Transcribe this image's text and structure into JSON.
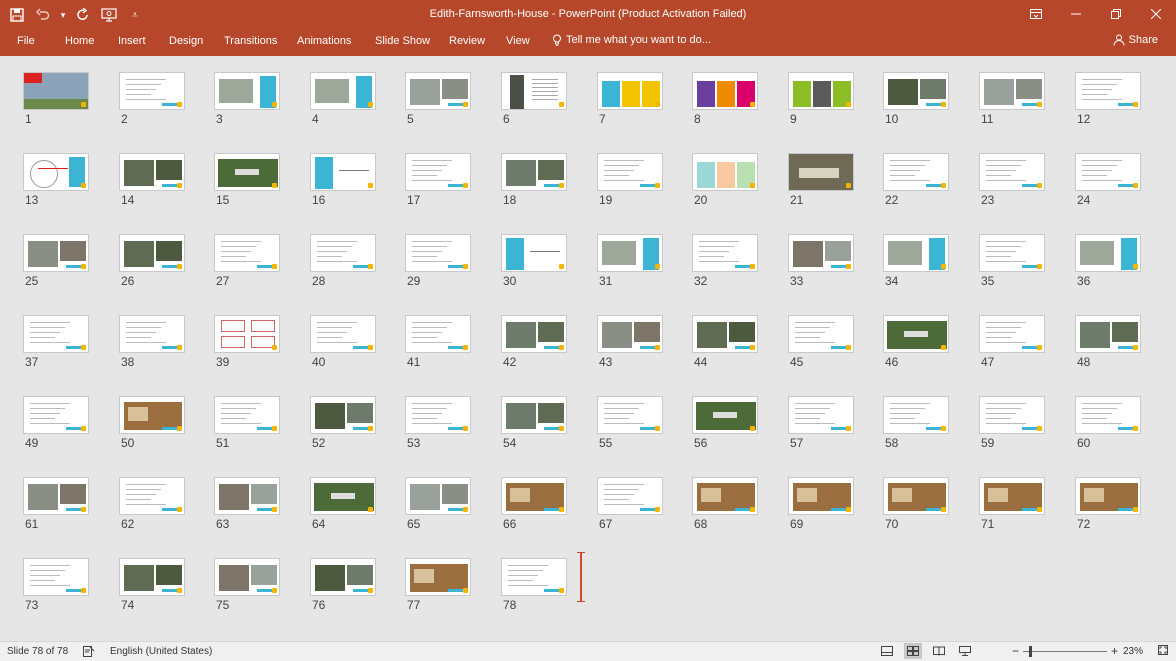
{
  "window": {
    "title": "Edith-Farnsworth-House - PowerPoint (Product Activation Failed)"
  },
  "qat": [
    {
      "icon": "save-icon",
      "glyph": "🖫"
    },
    {
      "icon": "undo-icon",
      "glyph": "↶"
    },
    {
      "icon": "undo-dropdown-icon",
      "glyph": "▾"
    },
    {
      "icon": "redo-icon",
      "glyph": "↻"
    },
    {
      "icon": "presentation-icon",
      "glyph": "⛭"
    },
    {
      "icon": "customize-qat-icon",
      "glyph": "⩡"
    }
  ],
  "tabs": [
    {
      "label": "File",
      "name": "tab-file"
    },
    {
      "label": "Home",
      "name": "tab-home"
    },
    {
      "label": "Insert",
      "name": "tab-insert"
    },
    {
      "label": "Design",
      "name": "tab-design"
    },
    {
      "label": "Transitions",
      "name": "tab-transitions"
    },
    {
      "label": "Animations",
      "name": "tab-animations"
    },
    {
      "label": "Slide Show",
      "name": "tab-slide-show"
    },
    {
      "label": "Review",
      "name": "tab-review"
    },
    {
      "label": "View",
      "name": "tab-view"
    }
  ],
  "tellme": {
    "label": "Tell me what you want to do..."
  },
  "share": {
    "label": "Share"
  },
  "status": {
    "slide_count": "Slide 78 of 78",
    "language": "English (United States)",
    "zoom": "23%"
  },
  "slides": {
    "count": 78,
    "columns": 12
  }
}
